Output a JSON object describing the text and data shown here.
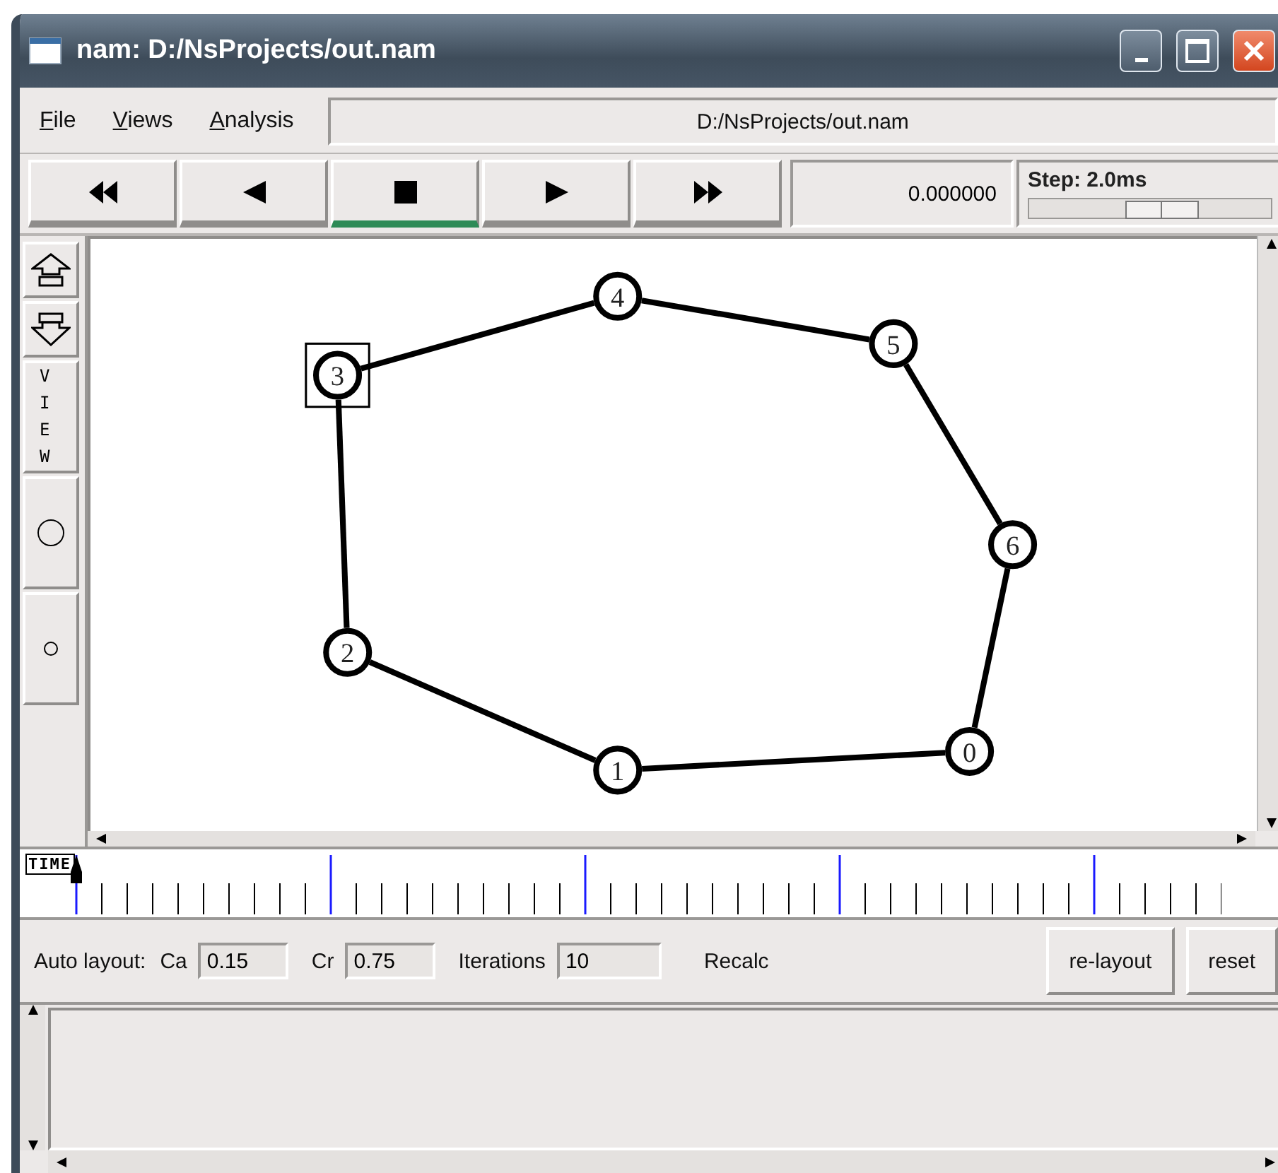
{
  "window": {
    "title": "nam: D:/NsProjects/out.nam"
  },
  "menu": [
    "File",
    "Views",
    "Analysis"
  ],
  "file_path": "D:/NsProjects/out.nam",
  "playback": [
    {
      "kind": "rewind",
      "selected": false
    },
    {
      "kind": "back",
      "selected": false
    },
    {
      "kind": "stop",
      "selected": true
    },
    {
      "kind": "play",
      "selected": false
    },
    {
      "kind": "forward",
      "selected": false
    }
  ],
  "time": "0.000000",
  "step": {
    "label": "Step: 2.0ms",
    "level": 0.55
  },
  "tools": [
    {
      "kind": "zoom-in"
    },
    {
      "kind": "zoom-out"
    },
    {
      "kind": "view",
      "label": "VIEW"
    },
    {
      "kind": "big-circle"
    },
    {
      "kind": "small-circle"
    }
  ],
  "nodes": [
    {
      "label": "3",
      "selected": true
    },
    {
      "label": "4",
      "selected": false
    },
    {
      "label": "5",
      "selected": false
    },
    {
      "label": "6",
      "selected": false
    },
    {
      "label": "0",
      "selected": false
    },
    {
      "label": "1",
      "selected": false
    },
    {
      "label": "2",
      "selected": false
    }
  ],
  "timeline": {
    "label": "TIME",
    "level": 0
  },
  "auto_layout": {
    "label": "Auto layout:",
    "fields": [
      {
        "label": "Ca",
        "value": "0.15"
      },
      {
        "label": "Cr",
        "value": "0.75"
      },
      {
        "label": "Iterations",
        "value": "10"
      }
    ],
    "recalc": "Recalc",
    "buttons": [
      "re-layout",
      "reset"
    ]
  }
}
